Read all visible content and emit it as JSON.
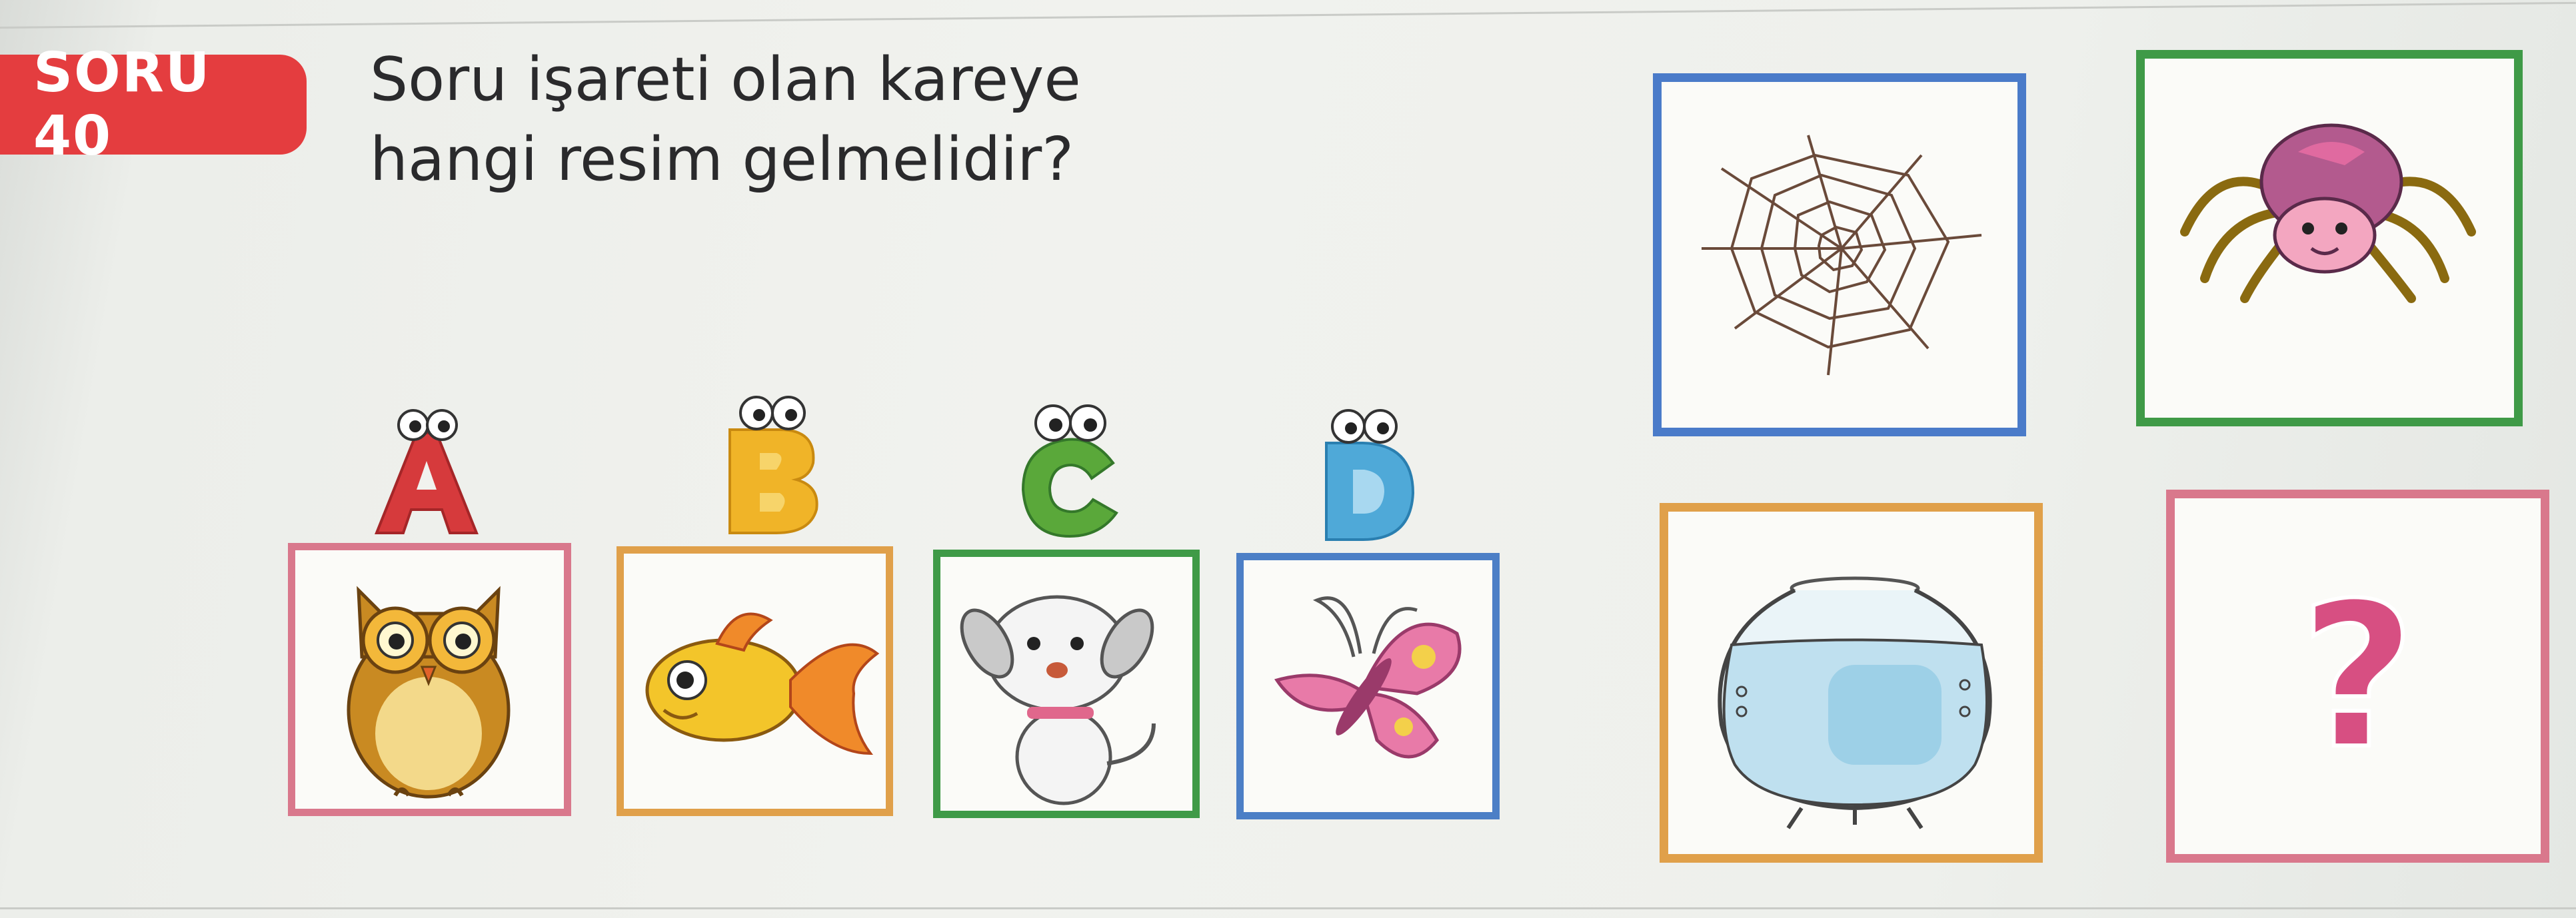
{
  "badge": {
    "label": "SORU 40"
  },
  "question": {
    "line1": "Soru işareti olan kareye",
    "line2": "hangi resim gelmelidir?"
  },
  "options": [
    {
      "letter": "A",
      "letter_color": "#d63a3c",
      "picture": "owl-icon",
      "frame_color": "#d9788c"
    },
    {
      "letter": "B",
      "letter_color": "#f0b428",
      "picture": "fish-icon",
      "frame_color": "#e0a04a"
    },
    {
      "letter": "C",
      "letter_color": "#5aa83a",
      "picture": "dog-icon",
      "frame_color": "#3f9a47"
    },
    {
      "letter": "D",
      "letter_color": "#4fa9d8",
      "picture": "butterfly-icon",
      "frame_color": "#4c7fc6"
    }
  ],
  "grid": [
    {
      "picture": "spider-web-icon",
      "frame_color": "#4a7bc9"
    },
    {
      "picture": "spider-icon",
      "frame_color": "#3f9a47"
    },
    {
      "picture": "fishbowl-icon",
      "frame_color": "#e0a04a"
    },
    {
      "picture": "question-mark-icon",
      "frame_color": "#d9788c",
      "text": "?"
    }
  ],
  "colors": {
    "badge": "#e43d3f",
    "text": "#2a2a2c",
    "question_mark": "#d74f82"
  }
}
